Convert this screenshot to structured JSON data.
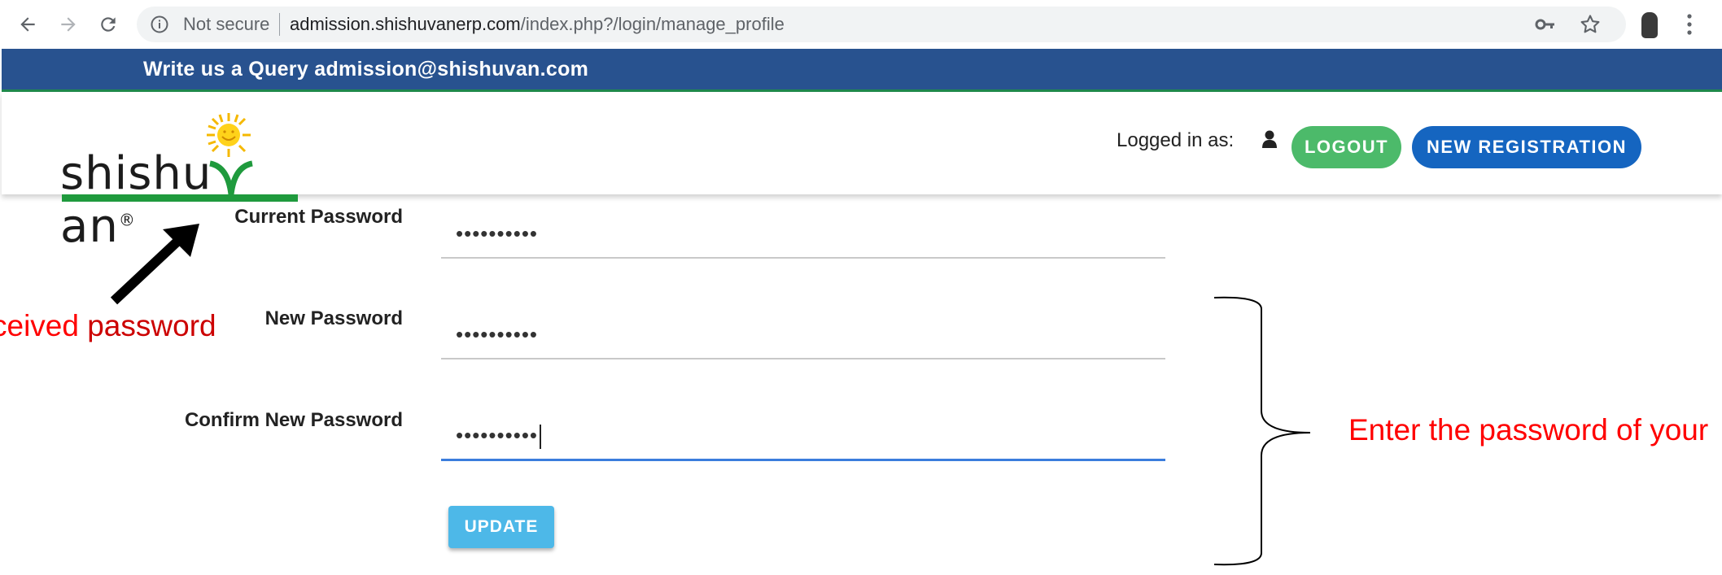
{
  "browser": {
    "security_label": "Not secure",
    "url_host": "admission.shishuvanerp.com",
    "url_path": "/index.php?/login/manage_profile"
  },
  "site": {
    "query_bar_text": "Write us a Query admission@shishuvan.com",
    "logo_text_a": "shishu",
    "logo_text_b": "an",
    "logo_mark": "®",
    "logged_in_label": "Logged in as:",
    "logout_label": "LOGOUT",
    "register_label": "NEW REGISTRATION"
  },
  "form": {
    "current_password_label": "Current Password",
    "current_password_value": "••••••••••",
    "new_password_label": "New Password",
    "new_password_value": "••••••••••",
    "confirm_password_label": "Confirm New Password",
    "confirm_password_value": "••••••••••",
    "update_label": "UPDATE"
  },
  "annotations": {
    "left_prefix": "ceived ",
    "left_highlight": "password",
    "right_text": "Enter the password of your"
  },
  "colors": {
    "query_bar": "#28528f",
    "logout": "#4cba6a",
    "register": "#1565c0",
    "update": "#4db8e8",
    "annotation": "#ff0000"
  }
}
